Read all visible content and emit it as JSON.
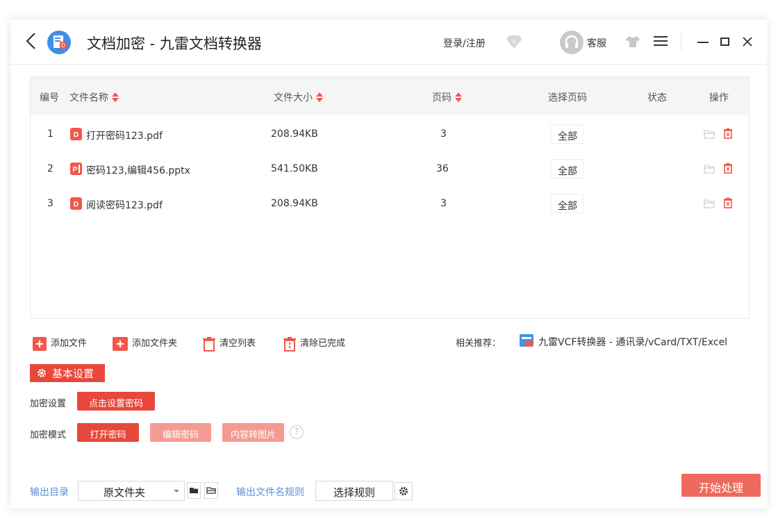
{
  "titlebar": {
    "title": "文档加密 - 九雷文档转换器",
    "login": "登录/注册",
    "service": "客服"
  },
  "table": {
    "headers": {
      "index": "编号",
      "name": "文件名称",
      "size": "文件大小",
      "pages": "页码",
      "select_pages": "选择页码",
      "status": "状态",
      "actions": "操作"
    },
    "rows": [
      {
        "index": "1",
        "name": "打开密码123.pdf",
        "type": "pdf",
        "size": "208.94KB",
        "pages": "3",
        "select": "全部"
      },
      {
        "index": "2",
        "name": "密码123,编辑456.pptx",
        "type": "pptx",
        "size": "541.50KB",
        "pages": "36",
        "select": "全部"
      },
      {
        "index": "3",
        "name": "阅读密码123.pdf",
        "type": "pdf",
        "size": "208.94KB",
        "pages": "3",
        "select": "全部"
      }
    ]
  },
  "toolbar": {
    "add_file": "添加文件",
    "add_folder": "添加文件夹",
    "clear_list": "清空列表",
    "clear_done": "清除已完成",
    "recommend_label": "相关推荐：",
    "recommend_link": "九雷VCF转换器 - 通讯录/vCard/TXT/Excel"
  },
  "settings": {
    "section_title": "基本设置",
    "encrypt_label": "加密设置",
    "set_password": "点击设置密码",
    "mode_label": "加密模式",
    "modes": [
      "打开密码",
      "编辑密码",
      "内容转图片"
    ],
    "active_mode": "打开密码",
    "help": "?"
  },
  "output": {
    "dir_label": "输出目录",
    "dir_value": "原文件夹",
    "rule_label": "输出文件名规则",
    "rule_button": "选择规则",
    "start": "开始处理"
  },
  "colors": {
    "accent": "#f1584a",
    "accent_light": "#f59a92",
    "link_blue": "#5b8ed8",
    "header_bg": "#f5f5f5"
  }
}
